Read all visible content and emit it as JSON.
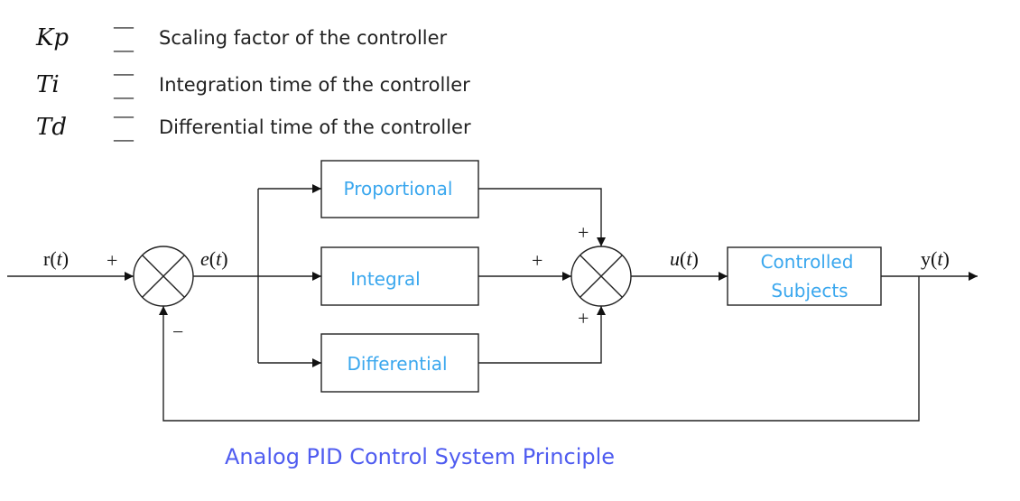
{
  "legend": [
    {
      "symbol": "Kp",
      "dash": "— —",
      "description": "Scaling factor of the controller"
    },
    {
      "symbol": "Ti",
      "dash": "— —",
      "description": "Integration time of the controller"
    },
    {
      "symbol": "Td",
      "dash": "— —",
      "description": "Differential time of the controller"
    }
  ],
  "blocks": {
    "proportional": "Proportional",
    "integral": "Integral",
    "differential": "Differential",
    "plant_line1": "Controlled",
    "plant_line2": "Subjects"
  },
  "signals": {
    "input_fn": "r",
    "input_arg": "t",
    "error_fn": "e",
    "error_arg": "t",
    "control_fn": "u",
    "control_arg": "t",
    "output_fn": "y",
    "output_arg": "t"
  },
  "signs": {
    "sum1_input": "+",
    "sum1_feedback": "−",
    "sum2_top": "+",
    "sum2_left": "+",
    "sum2_bottom": "+"
  },
  "colors": {
    "block_label": "#3aa7ee",
    "caption": "#4f5cf0",
    "line": "#111111"
  },
  "caption": "Analog PID Control System Principle"
}
